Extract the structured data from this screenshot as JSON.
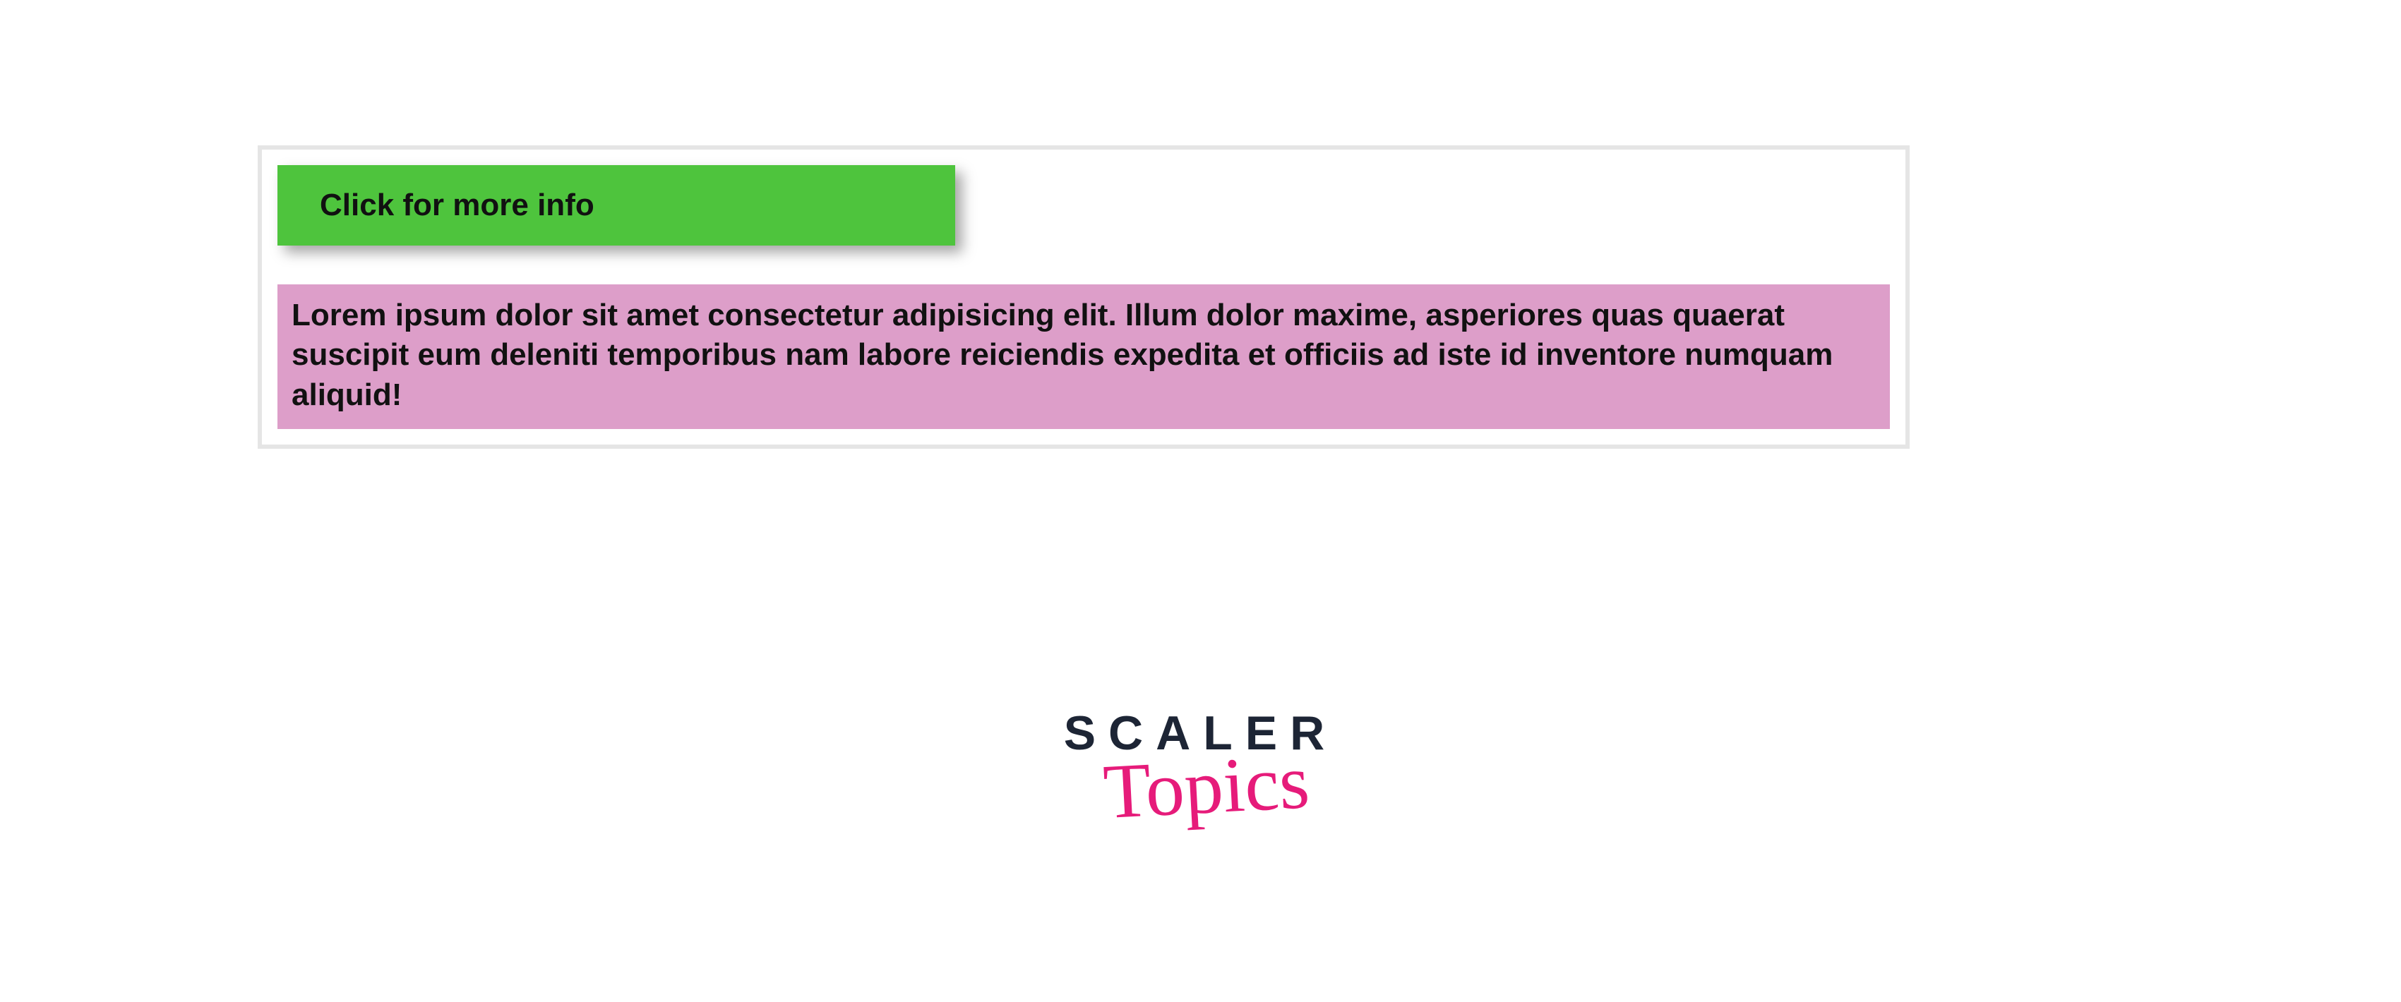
{
  "button": {
    "label": "Click for more info"
  },
  "panel": {
    "text": "Lorem ipsum dolor sit amet consectetur adipisicing elit. Illum dolor maxime, asperiores quas quaerat suscipit eum deleniti temporibus nam labore reiciendis expedita et officiis ad iste id inventore numquam aliquid!"
  },
  "logo": {
    "line1": "SCALER",
    "line2": "Topics"
  },
  "colors": {
    "button_bg": "#4ec43d",
    "panel_bg": "#dd9ec9",
    "border": "#e5e5e5",
    "logo_dark": "#1d2535",
    "logo_accent": "#e61b7a"
  }
}
